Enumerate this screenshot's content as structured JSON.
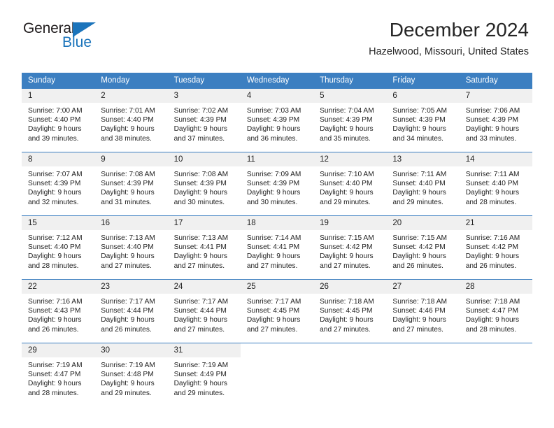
{
  "logo": {
    "text_primary": "General",
    "text_secondary": "Blue",
    "triangle_icon": "triangle-icon",
    "primary_color": "#231f20",
    "secondary_color": "#1b74bb"
  },
  "header": {
    "title": "December 2024",
    "subtitle": "Hazelwood, Missouri, United States"
  },
  "theme": {
    "header_bg": "#3c7fc1",
    "daynum_bg": "#f0f0f0",
    "text": "#222222"
  },
  "calendar": {
    "weekday_headers": [
      "Sunday",
      "Monday",
      "Tuesday",
      "Wednesday",
      "Thursday",
      "Friday",
      "Saturday"
    ],
    "weeks": [
      [
        {
          "day": "1",
          "sunrise": "Sunrise: 7:00 AM",
          "sunset": "Sunset: 4:40 PM",
          "daylight_line1": "Daylight: 9 hours",
          "daylight_line2": "and 39 minutes."
        },
        {
          "day": "2",
          "sunrise": "Sunrise: 7:01 AM",
          "sunset": "Sunset: 4:40 PM",
          "daylight_line1": "Daylight: 9 hours",
          "daylight_line2": "and 38 minutes."
        },
        {
          "day": "3",
          "sunrise": "Sunrise: 7:02 AM",
          "sunset": "Sunset: 4:39 PM",
          "daylight_line1": "Daylight: 9 hours",
          "daylight_line2": "and 37 minutes."
        },
        {
          "day": "4",
          "sunrise": "Sunrise: 7:03 AM",
          "sunset": "Sunset: 4:39 PM",
          "daylight_line1": "Daylight: 9 hours",
          "daylight_line2": "and 36 minutes."
        },
        {
          "day": "5",
          "sunrise": "Sunrise: 7:04 AM",
          "sunset": "Sunset: 4:39 PM",
          "daylight_line1": "Daylight: 9 hours",
          "daylight_line2": "and 35 minutes."
        },
        {
          "day": "6",
          "sunrise": "Sunrise: 7:05 AM",
          "sunset": "Sunset: 4:39 PM",
          "daylight_line1": "Daylight: 9 hours",
          "daylight_line2": "and 34 minutes."
        },
        {
          "day": "7",
          "sunrise": "Sunrise: 7:06 AM",
          "sunset": "Sunset: 4:39 PM",
          "daylight_line1": "Daylight: 9 hours",
          "daylight_line2": "and 33 minutes."
        }
      ],
      [
        {
          "day": "8",
          "sunrise": "Sunrise: 7:07 AM",
          "sunset": "Sunset: 4:39 PM",
          "daylight_line1": "Daylight: 9 hours",
          "daylight_line2": "and 32 minutes."
        },
        {
          "day": "9",
          "sunrise": "Sunrise: 7:08 AM",
          "sunset": "Sunset: 4:39 PM",
          "daylight_line1": "Daylight: 9 hours",
          "daylight_line2": "and 31 minutes."
        },
        {
          "day": "10",
          "sunrise": "Sunrise: 7:08 AM",
          "sunset": "Sunset: 4:39 PM",
          "daylight_line1": "Daylight: 9 hours",
          "daylight_line2": "and 30 minutes."
        },
        {
          "day": "11",
          "sunrise": "Sunrise: 7:09 AM",
          "sunset": "Sunset: 4:39 PM",
          "daylight_line1": "Daylight: 9 hours",
          "daylight_line2": "and 30 minutes."
        },
        {
          "day": "12",
          "sunrise": "Sunrise: 7:10 AM",
          "sunset": "Sunset: 4:40 PM",
          "daylight_line1": "Daylight: 9 hours",
          "daylight_line2": "and 29 minutes."
        },
        {
          "day": "13",
          "sunrise": "Sunrise: 7:11 AM",
          "sunset": "Sunset: 4:40 PM",
          "daylight_line1": "Daylight: 9 hours",
          "daylight_line2": "and 29 minutes."
        },
        {
          "day": "14",
          "sunrise": "Sunrise: 7:11 AM",
          "sunset": "Sunset: 4:40 PM",
          "daylight_line1": "Daylight: 9 hours",
          "daylight_line2": "and 28 minutes."
        }
      ],
      [
        {
          "day": "15",
          "sunrise": "Sunrise: 7:12 AM",
          "sunset": "Sunset: 4:40 PM",
          "daylight_line1": "Daylight: 9 hours",
          "daylight_line2": "and 28 minutes."
        },
        {
          "day": "16",
          "sunrise": "Sunrise: 7:13 AM",
          "sunset": "Sunset: 4:40 PM",
          "daylight_line1": "Daylight: 9 hours",
          "daylight_line2": "and 27 minutes."
        },
        {
          "day": "17",
          "sunrise": "Sunrise: 7:13 AM",
          "sunset": "Sunset: 4:41 PM",
          "daylight_line1": "Daylight: 9 hours",
          "daylight_line2": "and 27 minutes."
        },
        {
          "day": "18",
          "sunrise": "Sunrise: 7:14 AM",
          "sunset": "Sunset: 4:41 PM",
          "daylight_line1": "Daylight: 9 hours",
          "daylight_line2": "and 27 minutes."
        },
        {
          "day": "19",
          "sunrise": "Sunrise: 7:15 AM",
          "sunset": "Sunset: 4:42 PM",
          "daylight_line1": "Daylight: 9 hours",
          "daylight_line2": "and 27 minutes."
        },
        {
          "day": "20",
          "sunrise": "Sunrise: 7:15 AM",
          "sunset": "Sunset: 4:42 PM",
          "daylight_line1": "Daylight: 9 hours",
          "daylight_line2": "and 26 minutes."
        },
        {
          "day": "21",
          "sunrise": "Sunrise: 7:16 AM",
          "sunset": "Sunset: 4:42 PM",
          "daylight_line1": "Daylight: 9 hours",
          "daylight_line2": "and 26 minutes."
        }
      ],
      [
        {
          "day": "22",
          "sunrise": "Sunrise: 7:16 AM",
          "sunset": "Sunset: 4:43 PM",
          "daylight_line1": "Daylight: 9 hours",
          "daylight_line2": "and 26 minutes."
        },
        {
          "day": "23",
          "sunrise": "Sunrise: 7:17 AM",
          "sunset": "Sunset: 4:44 PM",
          "daylight_line1": "Daylight: 9 hours",
          "daylight_line2": "and 26 minutes."
        },
        {
          "day": "24",
          "sunrise": "Sunrise: 7:17 AM",
          "sunset": "Sunset: 4:44 PM",
          "daylight_line1": "Daylight: 9 hours",
          "daylight_line2": "and 27 minutes."
        },
        {
          "day": "25",
          "sunrise": "Sunrise: 7:17 AM",
          "sunset": "Sunset: 4:45 PM",
          "daylight_line1": "Daylight: 9 hours",
          "daylight_line2": "and 27 minutes."
        },
        {
          "day": "26",
          "sunrise": "Sunrise: 7:18 AM",
          "sunset": "Sunset: 4:45 PM",
          "daylight_line1": "Daylight: 9 hours",
          "daylight_line2": "and 27 minutes."
        },
        {
          "day": "27",
          "sunrise": "Sunrise: 7:18 AM",
          "sunset": "Sunset: 4:46 PM",
          "daylight_line1": "Daylight: 9 hours",
          "daylight_line2": "and 27 minutes."
        },
        {
          "day": "28",
          "sunrise": "Sunrise: 7:18 AM",
          "sunset": "Sunset: 4:47 PM",
          "daylight_line1": "Daylight: 9 hours",
          "daylight_line2": "and 28 minutes."
        }
      ],
      [
        {
          "day": "29",
          "sunrise": "Sunrise: 7:19 AM",
          "sunset": "Sunset: 4:47 PM",
          "daylight_line1": "Daylight: 9 hours",
          "daylight_line2": "and 28 minutes."
        },
        {
          "day": "30",
          "sunrise": "Sunrise: 7:19 AM",
          "sunset": "Sunset: 4:48 PM",
          "daylight_line1": "Daylight: 9 hours",
          "daylight_line2": "and 29 minutes."
        },
        {
          "day": "31",
          "sunrise": "Sunrise: 7:19 AM",
          "sunset": "Sunset: 4:49 PM",
          "daylight_line1": "Daylight: 9 hours",
          "daylight_line2": "and 29 minutes."
        },
        {
          "day": "",
          "sunrise": "",
          "sunset": "",
          "daylight_line1": "",
          "daylight_line2": ""
        },
        {
          "day": "",
          "sunrise": "",
          "sunset": "",
          "daylight_line1": "",
          "daylight_line2": ""
        },
        {
          "day": "",
          "sunrise": "",
          "sunset": "",
          "daylight_line1": "",
          "daylight_line2": ""
        },
        {
          "day": "",
          "sunrise": "",
          "sunset": "",
          "daylight_line1": "",
          "daylight_line2": ""
        }
      ]
    ]
  }
}
